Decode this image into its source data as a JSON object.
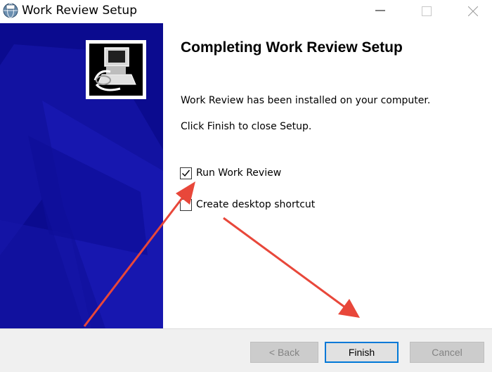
{
  "window": {
    "title": "Work Review Setup",
    "icon": "installer-globe-icon"
  },
  "content": {
    "heading": "Completing Work Review Setup",
    "line1": "Work Review has been installed on your computer.",
    "line2": "Click Finish to close Setup."
  },
  "options": {
    "run_label": "Run Work Review",
    "run_checked": true,
    "desktop_label": "Create desktop shortcut",
    "desktop_checked": false
  },
  "buttons": {
    "back": "< Back",
    "finish": "Finish",
    "cancel": "Cancel"
  },
  "colors": {
    "sidebar": "#0b0b8f",
    "annotation_arrow": "#e8473a",
    "focus_border": "#0078d7"
  }
}
